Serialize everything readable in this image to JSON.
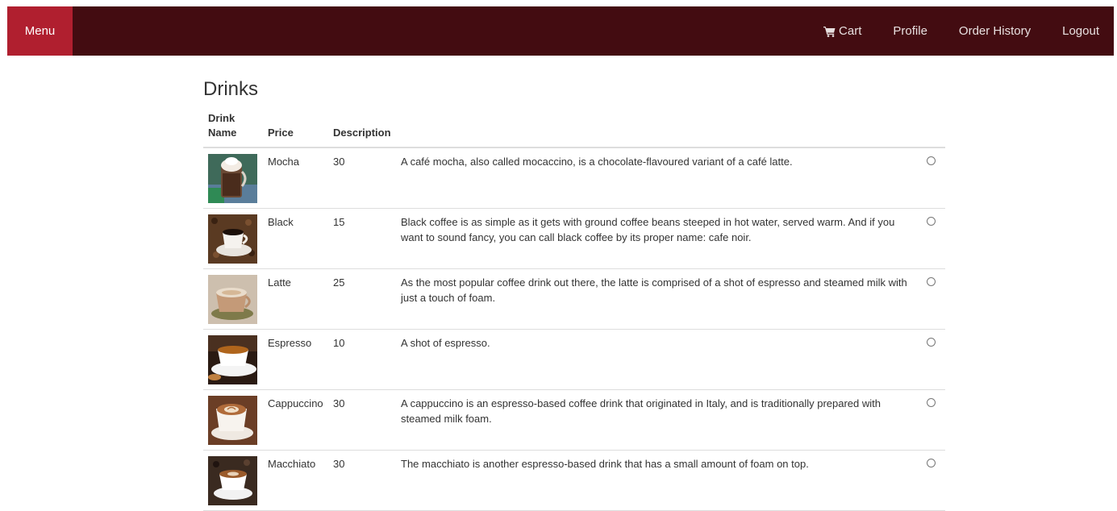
{
  "navbar": {
    "brand": "Menu",
    "links": {
      "cart": "Cart",
      "profile": "Profile",
      "order_history": "Order History",
      "logout": "Logout"
    },
    "colors": {
      "bar": "#430c11",
      "brand": "#b01f2f"
    }
  },
  "page": {
    "title": "Drinks"
  },
  "table": {
    "headers": {
      "name": "Drink Name",
      "price": "Price",
      "description": "Description"
    },
    "rows": [
      {
        "image_icon": "mocha-photo",
        "name": "Mocha",
        "price": "30",
        "description": "A café mocha, also called mocaccino, is a chocolate-flavoured variant of a café latte."
      },
      {
        "image_icon": "black-coffee-photo",
        "name": "Black",
        "price": "15",
        "description": "Black coffee is as simple as it gets with ground coffee beans steeped in hot water, served warm. And if you want to sound fancy, you can call black coffee by its proper name: cafe noir."
      },
      {
        "image_icon": "latte-photo",
        "name": "Latte",
        "price": "25",
        "description": "As the most popular coffee drink out there, the latte is comprised of a shot of espresso and steamed milk with just a touch of foam."
      },
      {
        "image_icon": "espresso-photo",
        "name": "Espresso",
        "price": "10",
        "description": "A shot of espresso."
      },
      {
        "image_icon": "cappuccino-photo",
        "name": "Cappuccino",
        "price": "30",
        "description": "A cappuccino is an espresso-based coffee drink that originated in Italy, and is traditionally prepared with steamed milk foam."
      },
      {
        "image_icon": "macchiato-photo",
        "name": "Macchiato",
        "price": "30",
        "description": "The macchiato is another espresso-based drink that has a small amount of foam on top."
      }
    ]
  }
}
